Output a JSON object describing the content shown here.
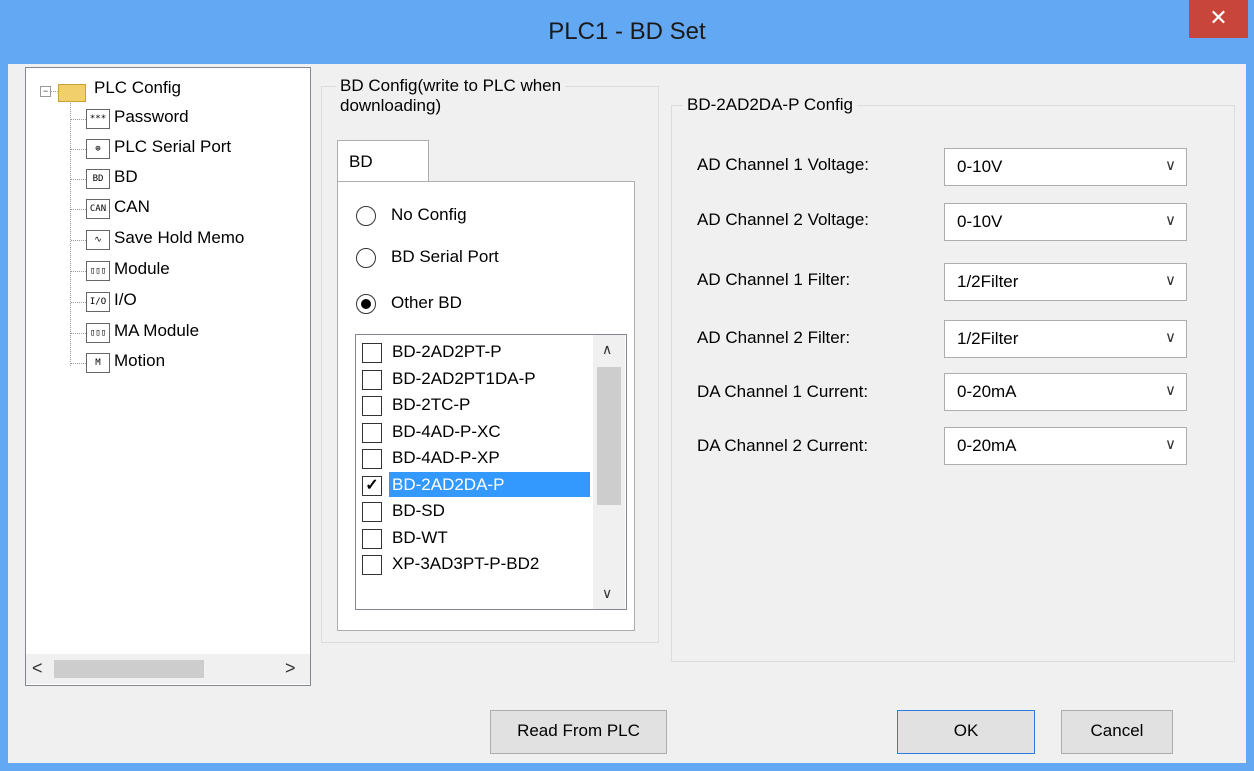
{
  "window": {
    "title": "PLC1 - BD  Set",
    "close_glyph": "✕"
  },
  "tree": {
    "root_label": "PLC Config",
    "root_expander": "−",
    "items": [
      {
        "label": "Password",
        "icon": "password-icon",
        "glyph": "***"
      },
      {
        "label": "PLC Serial Port",
        "icon": "serial-port-icon",
        "glyph": "⊕"
      },
      {
        "label": "BD",
        "icon": "bd-icon",
        "glyph": "BD"
      },
      {
        "label": "CAN",
        "icon": "can-icon",
        "glyph": "CAN"
      },
      {
        "label": "Save Hold Memo",
        "icon": "save-hold-memo-icon",
        "glyph": "∿"
      },
      {
        "label": "Module",
        "icon": "module-icon",
        "glyph": "▯▯▯"
      },
      {
        "label": "I/O",
        "icon": "io-icon",
        "glyph": "I/O"
      },
      {
        "label": "MA Module",
        "icon": "ma-module-icon",
        "glyph": "▯▯▯"
      },
      {
        "label": "Motion",
        "icon": "motion-icon",
        "glyph": "M"
      }
    ],
    "scroll_left": "<",
    "scroll_right": ">"
  },
  "bd_config": {
    "group_title_line1": "BD Config(write to PLC when",
    "group_title_line2": "downloading)",
    "tab_label": "BD",
    "radios": [
      {
        "label": "No Config",
        "selected": false
      },
      {
        "label": "BD Serial Port",
        "selected": false
      },
      {
        "label": "Other BD",
        "selected": true
      }
    ],
    "checklist": [
      {
        "label": "BD-2AD2PT-P",
        "checked": false,
        "mark": ""
      },
      {
        "label": "BD-2AD2PT1DA-P",
        "checked": false,
        "mark": ""
      },
      {
        "label": "BD-2TC-P",
        "checked": false,
        "mark": ""
      },
      {
        "label": "BD-4AD-P-XC",
        "checked": false,
        "mark": ""
      },
      {
        "label": "BD-4AD-P-XP",
        "checked": false,
        "mark": ""
      },
      {
        "label": "BD-2AD2DA-P",
        "checked": true,
        "mark": "✓",
        "selected": true
      },
      {
        "label": "BD-SD",
        "checked": false,
        "mark": ""
      },
      {
        "label": "BD-WT",
        "checked": false,
        "mark": ""
      },
      {
        "label": "XP-3AD3PT-P-BD2",
        "checked": false,
        "mark": ""
      }
    ],
    "scroll_up": "∧",
    "scroll_down": "∨"
  },
  "device_config": {
    "group_title": "BD-2AD2DA-P Config",
    "rows": [
      {
        "label": "AD Channel 1 Voltage:",
        "value": "0-10V"
      },
      {
        "label": "AD Channel 2 Voltage:",
        "value": "0-10V"
      },
      {
        "label": "AD Channel 1 Filter:",
        "value": "1/2Filter"
      },
      {
        "label": "AD Channel 2 Filter:",
        "value": "1/2Filter"
      },
      {
        "label": "DA Channel 1 Current:",
        "value": "0-20mA"
      },
      {
        "label": "DA Channel 2 Current:",
        "value": "0-20mA"
      }
    ],
    "dropdown_glyph": "∨"
  },
  "buttons": {
    "read_from_plc": "Read From PLC",
    "ok": "OK",
    "cancel": "Cancel"
  },
  "colors": {
    "title_bar": "#62a8f3",
    "close_button": "#c7453b",
    "selection": "#3399ff",
    "corner_accent": "#e8302a"
  }
}
